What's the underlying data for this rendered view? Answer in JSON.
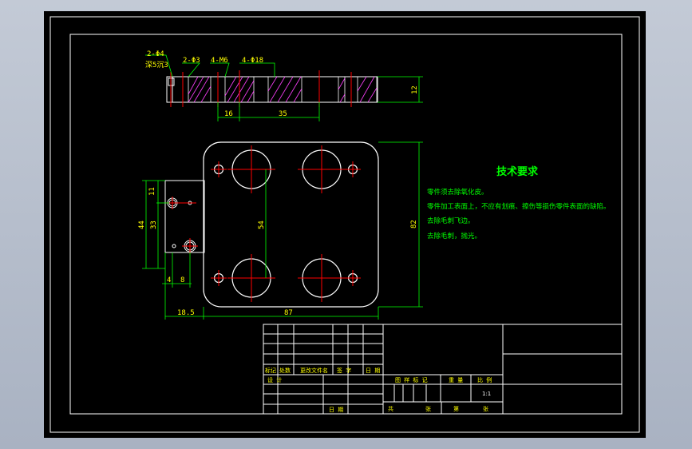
{
  "drawing": {
    "top_view": {
      "callouts": [
        "2-Φ4",
        "深5沉3",
        "2-Φ3",
        "4-M6",
        "4-Φ18"
      ],
      "dims": [
        "16",
        "35",
        "12"
      ]
    },
    "front_view": {
      "dims": [
        "11",
        "33",
        "44",
        "54",
        "82",
        "4",
        "8",
        "18.5",
        "87"
      ]
    },
    "tech": {
      "title": "技术要求",
      "lines": [
        "零件须去除氧化皮。",
        "零件加工表面上，不应有划痕、擦伤等损伤零件表面的缺陷。",
        "去除毛刺飞边。",
        "去除毛刺，抛光。"
      ]
    },
    "title_block": {
      "rev_headers": [
        "标记",
        "处数",
        "更改文件名",
        "签 字",
        "日 期"
      ],
      "design": "设 计",
      "date": "日 期",
      "attr_headers": [
        "图 样 标 记",
        "重 量",
        "比 例"
      ],
      "scale": "1:1",
      "sheet_total": "共",
      "sheet_total_unit": "张",
      "sheet_no": "第",
      "sheet_no_unit": "张"
    }
  },
  "colors": {
    "frame": "#000000",
    "line": "#ffffff",
    "center": "#ff0000",
    "dim": "#00ff00",
    "hatch": "#ff00ff"
  }
}
